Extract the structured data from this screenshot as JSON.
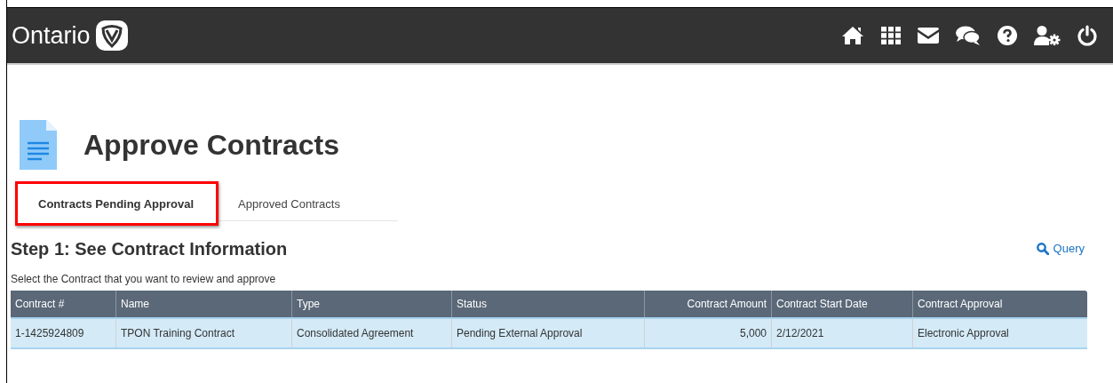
{
  "header": {
    "brand": "Ontario",
    "icons": [
      {
        "kind": "home"
      },
      {
        "kind": "grid"
      },
      {
        "kind": "mail"
      },
      {
        "kind": "chat"
      },
      {
        "kind": "help"
      },
      {
        "kind": "usergear"
      },
      {
        "kind": "power"
      }
    ]
  },
  "page_title": "Approve Contracts",
  "tabs": [
    {
      "label": "Contracts Pending Approval",
      "selected": true,
      "highlighted": true
    },
    {
      "label": "Approved Contracts",
      "selected": false,
      "highlighted": false
    }
  ],
  "section_title": "Step 1: See Contract Information",
  "query_link": "Query",
  "instructions": "Select the Contract that you want to review and approve",
  "table": {
    "columns": [
      {
        "label": "Contract #",
        "kind": "text"
      },
      {
        "label": "Name",
        "kind": "text"
      },
      {
        "label": "Type",
        "kind": "text"
      },
      {
        "label": "Status",
        "kind": "text"
      },
      {
        "label": "Contract Amount",
        "kind": "amount"
      },
      {
        "label": "Contract Start Date",
        "kind": "text"
      },
      {
        "label": "Contract Approval",
        "kind": "text"
      }
    ],
    "rows": [
      {
        "selected": true,
        "cells": [
          "1-1425924809",
          "TPON Training Contract",
          "Consolidated Agreement",
          "Pending External Approval",
          "5,000",
          "2/12/2021",
          "Electronic Approval"
        ]
      }
    ]
  }
}
